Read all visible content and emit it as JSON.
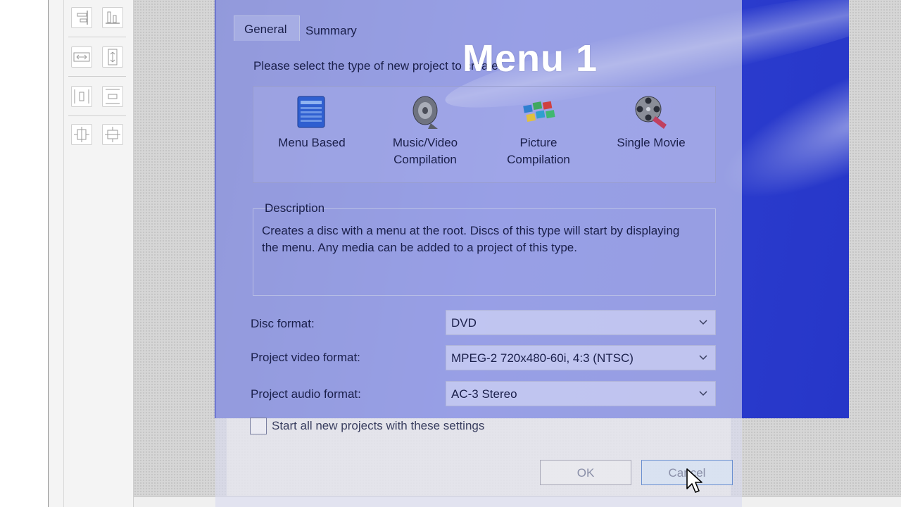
{
  "menu_title": "Menu 1",
  "dialog": {
    "tabs": [
      "General",
      "Summary"
    ],
    "prompt": "Please select the type of new project to create:",
    "project_types": [
      {
        "label_line1": "Menu Based",
        "label_line2": "",
        "icon": "menu-based-icon"
      },
      {
        "label_line1": "Music/Video",
        "label_line2": "Compilation",
        "icon": "speaker-icon"
      },
      {
        "label_line1": "Picture",
        "label_line2": "Compilation",
        "icon": "picture-grid-icon"
      },
      {
        "label_line1": "Single Movie",
        "label_line2": "",
        "icon": "film-reel-icon"
      }
    ],
    "description_title": "Description",
    "description_text": "Creates a disc with a menu at the root. Discs of this type will start by displaying the menu. Any media can be added to a project of this type.",
    "fields": {
      "disc_format_label": "Disc format:",
      "disc_format_value": "DVD",
      "video_format_label": "Project video format:",
      "video_format_value": "MPEG-2 720x480-60i, 4:3 (NTSC)",
      "audio_format_label": "Project audio format:",
      "audio_format_value": "AC-3 Stereo"
    },
    "remember_label": "Start all new projects with these settings",
    "remember_checked": false,
    "ok_label": "OK",
    "cancel_label": "Cancel"
  },
  "colors": {
    "menu_blue": "#2b3cce",
    "dialog_overlay": "#dadcf0"
  }
}
